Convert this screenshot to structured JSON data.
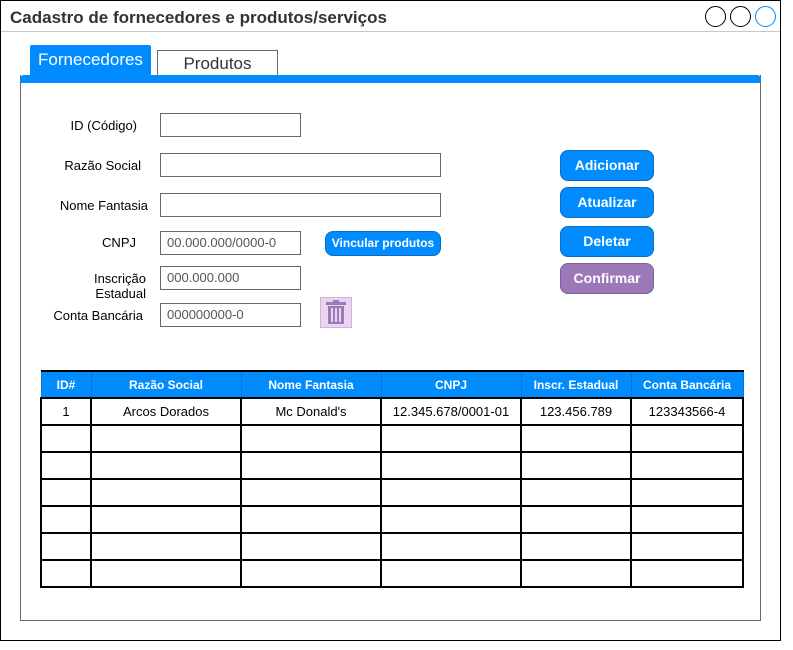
{
  "window": {
    "title": "Cadastro de fornecedores e produtos/serviços",
    "accent_color": "#008cff",
    "controls": [
      "circle-icon",
      "circle-icon",
      "circle-icon"
    ]
  },
  "tabs": [
    {
      "label": "Fornecedores",
      "active": true
    },
    {
      "label": "Produtos",
      "active": false
    }
  ],
  "form": {
    "id": {
      "label": "ID (Código)",
      "value": ""
    },
    "razao_social": {
      "label": "Razão Social",
      "value": ""
    },
    "nome_fantasia": {
      "label": "Nome Fantasia",
      "value": ""
    },
    "cnpj": {
      "label": "CNPJ",
      "placeholder": "00.000.000/0000-0"
    },
    "inscricao_estadual": {
      "label": "Inscrição Estadual",
      "placeholder": "000.000.000"
    },
    "conta_bancaria": {
      "label": "Conta Bancária",
      "placeholder": "000000000-0"
    },
    "vincular_label": "Vincular produtos",
    "trash_icon": "trash-icon"
  },
  "actions": {
    "adicionar": "Adicionar",
    "atualizar": "Atualizar",
    "deletar": "Deletar",
    "confirmar": "Confirmar",
    "confirm_color": "#9b78b8"
  },
  "table": {
    "columns": [
      "ID#",
      "Razão Social",
      "Nome Fantasia",
      "CNPJ",
      "Inscr. Estadual",
      "Conta Bancária"
    ],
    "rows": [
      [
        "1",
        "Arcos Dorados",
        "Mc Donald's",
        "12.345.678/0001-01",
        "123.456.789",
        "123343566-4"
      ],
      [
        "",
        "",
        "",
        "",
        "",
        ""
      ],
      [
        "",
        "",
        "",
        "",
        "",
        ""
      ],
      [
        "",
        "",
        "",
        "",
        "",
        ""
      ],
      [
        "",
        "",
        "",
        "",
        "",
        ""
      ],
      [
        "",
        "",
        "",
        "",
        "",
        ""
      ],
      [
        "",
        "",
        "",
        "",
        "",
        ""
      ]
    ]
  }
}
